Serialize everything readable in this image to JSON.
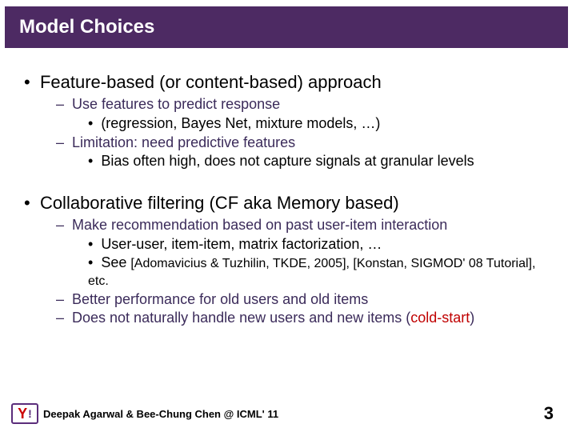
{
  "title": "Model Choices",
  "section1": {
    "heading": "Feature-based (or content-based) approach",
    "sub1": "Use features to predict response",
    "sub1a": "(regression, Bayes Net, mixture models, …)",
    "sub2": "Limitation: need predictive features",
    "sub2a": "Bias often high, does not capture signals at granular levels"
  },
  "section2": {
    "heading": "Collaborative filtering (CF aka Memory based)",
    "sub1": "Make recommendation based on past user-item interaction",
    "sub1a": "User-user, item-item, matrix factorization, …",
    "sub1b_lead": "See ",
    "sub1b_refs": "[Adomavicius & Tuzhilin, TKDE, 2005], [Konstan, SIGMOD' 08 Tutorial], etc.",
    "sub2": "Better performance for old users and old items",
    "sub3_lead": "Does not naturally handle new users and new items (",
    "sub3_cold": "cold-start",
    "sub3_tail": ")"
  },
  "footer": {
    "credit": "Deepak Agarwal & Bee-Chung Chen @ ICML' 11",
    "page": "3",
    "logo_y": "Y",
    "logo_bang": "!"
  }
}
